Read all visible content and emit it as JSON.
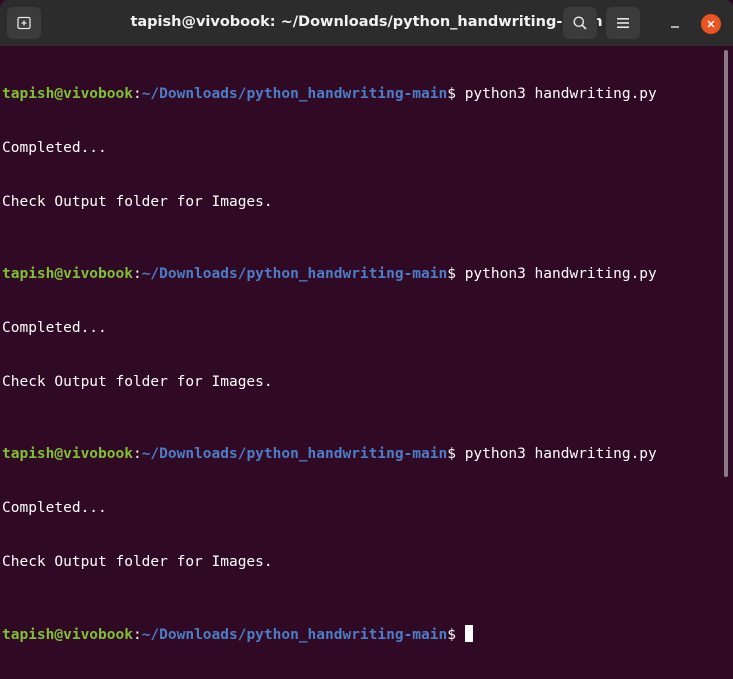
{
  "window": {
    "title": "tapish@vivobook: ~/Downloads/python_handwriting-main"
  },
  "colors": {
    "background": "#300a24",
    "user_host": "#7fc034",
    "path": "#4c7dc6",
    "close_button": "#e95420"
  },
  "icons": {
    "new_tab": "new-tab-icon",
    "search": "search-icon",
    "menu": "hamburger-menu-icon",
    "minimize": "minimize-icon",
    "close": "close-icon"
  },
  "terminal": {
    "prompts": [
      {
        "user_host": "tapish@vivobook",
        "colon": ":",
        "path": "~/Downloads/python_handwriting-main",
        "symbol": "$ ",
        "command": "python3 handwriting.py"
      },
      {
        "user_host": "tapish@vivobook",
        "colon": ":",
        "path": "~/Downloads/python_handwriting-main",
        "symbol": "$ ",
        "command": "python3 handwriting.py"
      },
      {
        "user_host": "tapish@vivobook",
        "colon": ":",
        "path": "~/Downloads/python_handwriting-main",
        "symbol": "$ ",
        "command": "python3 handwriting.py"
      },
      {
        "user_host": "tapish@vivobook",
        "colon": ":",
        "path": "~/Downloads/python_handwriting-main",
        "symbol": "$ ",
        "command": ""
      }
    ],
    "outputs": [
      [
        "Completed...",
        "Check Output folder for Images."
      ],
      [
        "Completed...",
        "Check Output folder for Images."
      ],
      [
        "Completed...",
        "Check Output folder for Images."
      ]
    ]
  }
}
